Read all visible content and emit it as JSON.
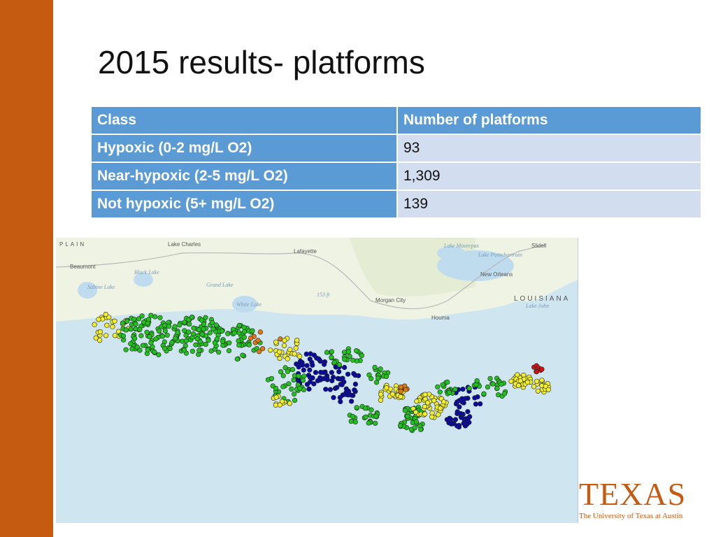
{
  "slide": {
    "title": "2015 results- platforms",
    "accent_color": "#c55a11"
  },
  "table": {
    "headers": [
      "Class",
      "Number of platforms"
    ],
    "rows": [
      {
        "class": "Hypoxic (0-2 mg/L O2)",
        "count": "93"
      },
      {
        "class": "Near-hypoxic (2-5 mg/L O2)",
        "count": "1,309"
      },
      {
        "class": "Not hypoxic (5+ mg/L O2)",
        "count": "139"
      }
    ]
  },
  "map": {
    "labels": [
      "PLAIN",
      "Lake Charles",
      "Lafayette",
      "Beaumont",
      "Black Lake",
      "Sabine Lake",
      "Grand Lake",
      "White Lake",
      "153 ft",
      "Morgan City",
      "Houma",
      "Lake Maurepas",
      "Lake Pontchartrain",
      "Slidell",
      "New Orleans",
      "LOUISIANA",
      "Lake John"
    ],
    "dot_colors": {
      "green": "#22c21e",
      "yellow": "#f2ef2a",
      "blue": "#0a0aa0",
      "orange": "#e07a10",
      "red": "#d21010"
    }
  },
  "logo": {
    "wordmark": "TEXAS",
    "subtitle": "The University of Texas at Austin"
  }
}
